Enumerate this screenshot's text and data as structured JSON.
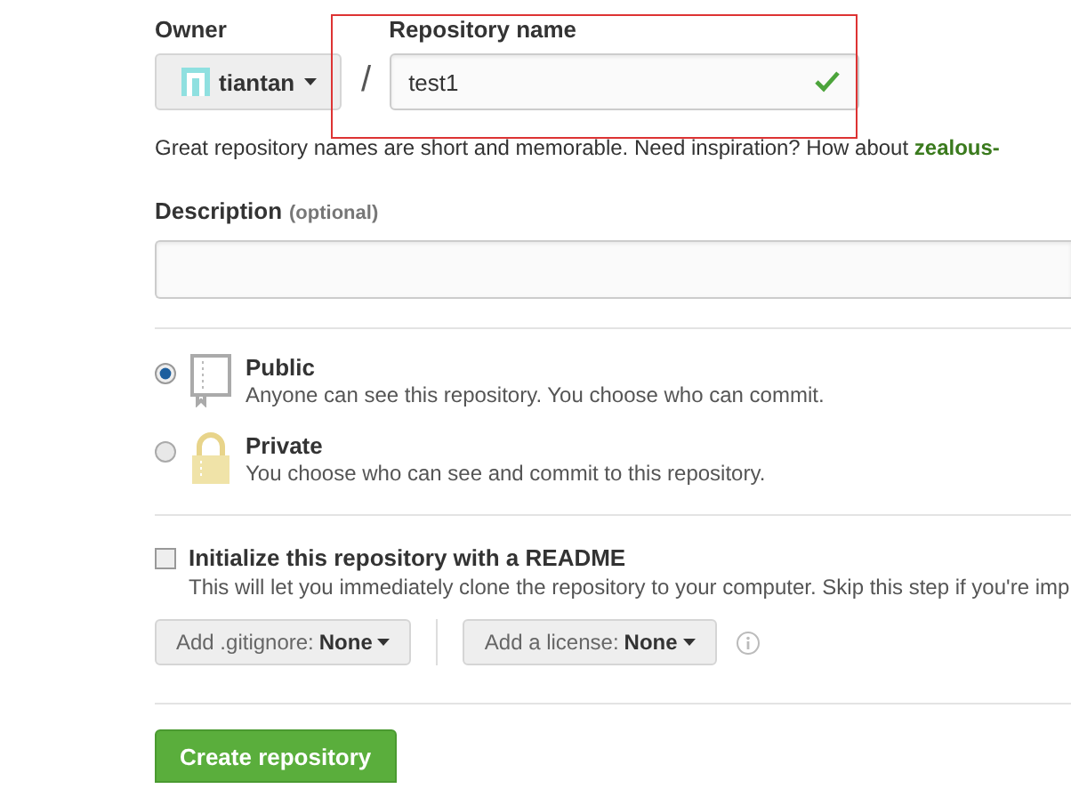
{
  "owner": {
    "label": "Owner",
    "value": "tiantan"
  },
  "separator": "/",
  "repository_name": {
    "label": "Repository name",
    "value": "test1",
    "valid": true,
    "highlighted": true
  },
  "hint": "Great repository names are short and memorable. Need inspiration? How about **zealous-**",
  "description": {
    "label": "Description",
    "optional": "(optional)"
  },
  "visibility": [
    {
      "kind": "book",
      "title": "Public",
      "text": "Anyone can see this repository. You choose who can commit.",
      "selected": true
    },
    {
      "kind": "lock",
      "title": "Private",
      "text": "You choose who can see and commit to this repository.",
      "selected": false
    }
  ],
  "readme": {
    "title": "Initialize this repository with a README",
    "text": "This will let you immediately clone the repository to your computer. Skip this step if you're imp",
    "checked": false
  },
  "dropdowns": [
    {
      "label": "Add .gitignore:",
      "value": "None"
    },
    {
      "label": "Add a license:",
      "value": "None"
    }
  ],
  "submit": "Create repository"
}
